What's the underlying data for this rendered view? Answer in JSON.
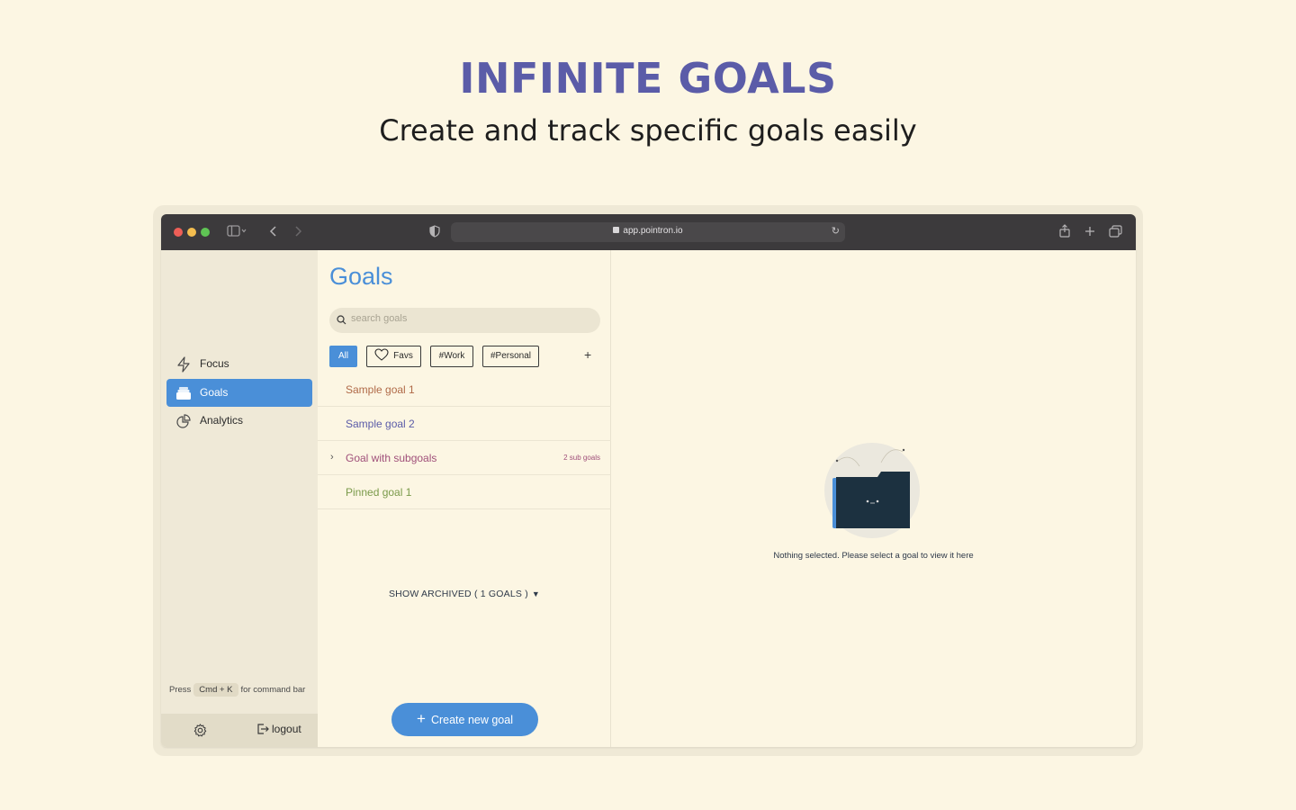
{
  "hero": {
    "title": "INFINITE GOALS",
    "subtitle": "Create and track specific goals easily"
  },
  "browser": {
    "url": "app.pointron.io",
    "traffic_colors": [
      "#ee5f57",
      "#f4bd4f",
      "#5fc454"
    ]
  },
  "sidebar": {
    "items": [
      {
        "label": "Focus",
        "icon": "lightning-icon",
        "active": false
      },
      {
        "label": "Goals",
        "icon": "stack-icon",
        "active": true
      },
      {
        "label": "Analytics",
        "icon": "pie-chart-icon",
        "active": false
      }
    ],
    "hint": {
      "prefix": "Press",
      "key": "Cmd + K",
      "suffix": "for command bar"
    },
    "footer": {
      "logout_label": "logout",
      "settings_icon": "gear-icon"
    }
  },
  "goals": {
    "title": "Goals",
    "search_placeholder": "search goals",
    "filters": [
      {
        "label": "All",
        "active": true
      },
      {
        "label": "Favs",
        "icon": "heart-icon",
        "active": false
      },
      {
        "label": "#Work",
        "active": false
      },
      {
        "label": "#Personal",
        "active": false
      }
    ],
    "add_filter_label": "+",
    "items": [
      {
        "label": "Sample goal 1",
        "color": "#b06a48"
      },
      {
        "label": "Sample goal 2",
        "color": "#5b5ca8"
      },
      {
        "label": "Goal with subgoals",
        "color": "#a0507a",
        "expand": "›",
        "sub": "2 sub goals"
      },
      {
        "label": "Pinned goal 1",
        "color": "#7a9a4a"
      }
    ],
    "archived_label": "SHOW ARCHIVED ( 1 GOALS )",
    "archived_arrow": "▼",
    "create_label": "Create new goal",
    "create_plus": "+"
  },
  "detail": {
    "empty_text": "Nothing selected. Please select a goal to view it here"
  },
  "colors": {
    "accent": "#4a8fd8",
    "hero_title": "#5b5ca8",
    "background": "#fcf6e3"
  }
}
